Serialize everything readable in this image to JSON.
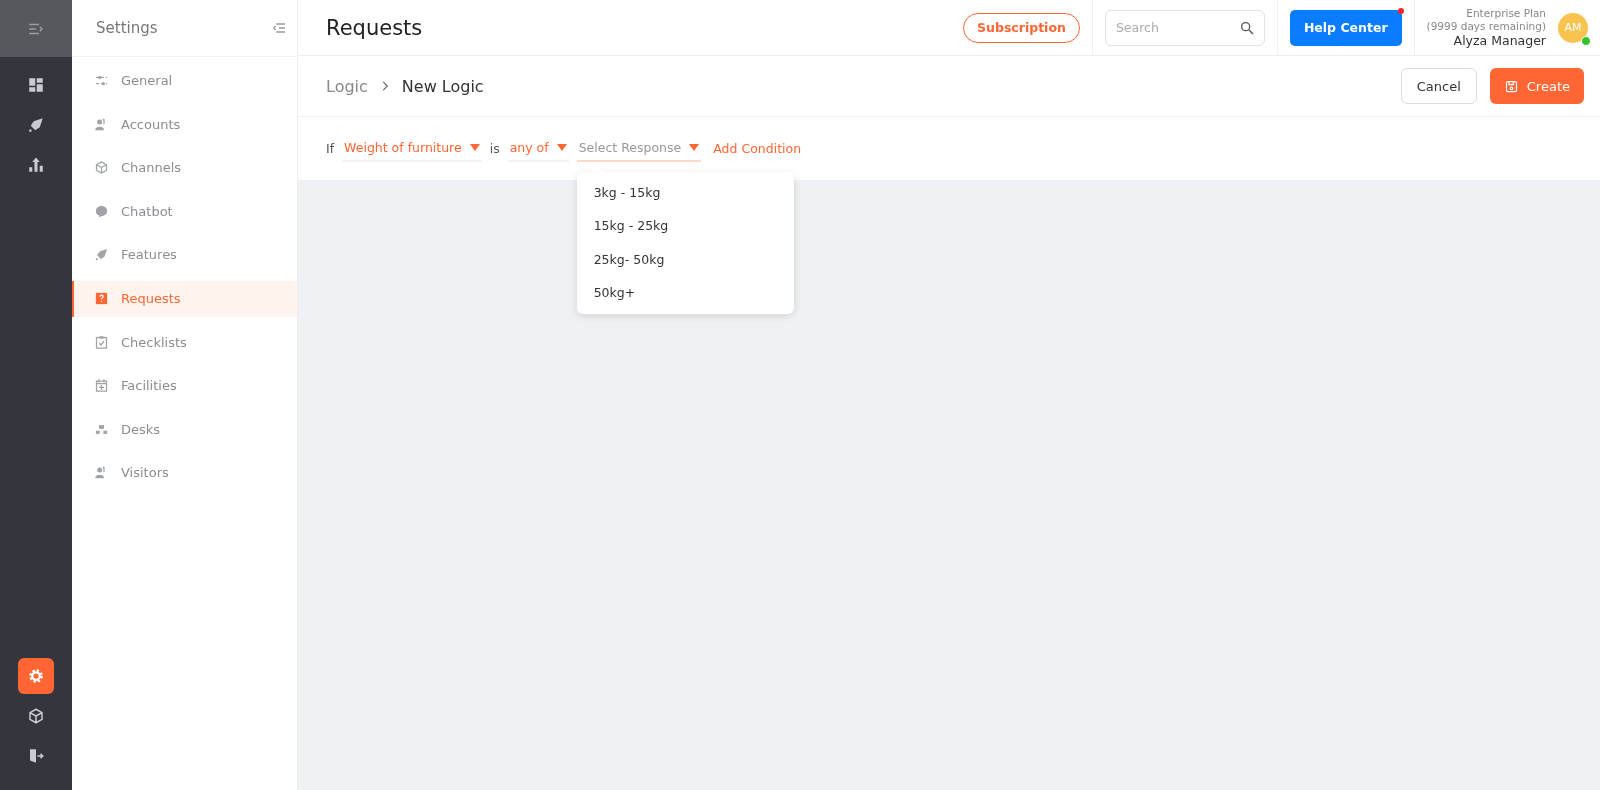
{
  "rail": {
    "items": [
      {
        "selected": false
      },
      {
        "selected": false
      },
      {
        "selected": false
      }
    ],
    "bottom_items": [
      {
        "selected": true
      },
      {
        "selected": false
      },
      {
        "selected": false
      }
    ]
  },
  "sidebar": {
    "title": "Settings",
    "items": [
      {
        "label": "General",
        "selected": false
      },
      {
        "label": "Accounts",
        "selected": false
      },
      {
        "label": "Channels",
        "selected": false
      },
      {
        "label": "Chatbot",
        "selected": false
      },
      {
        "label": "Features",
        "selected": false
      },
      {
        "label": "Requests",
        "selected": true
      },
      {
        "label": "Checklists",
        "selected": false
      },
      {
        "label": "Facilities",
        "selected": false
      },
      {
        "label": "Desks",
        "selected": false
      },
      {
        "label": "Visitors",
        "selected": false
      }
    ]
  },
  "header": {
    "title": "Requests",
    "subscription": "Subscription",
    "search": {
      "placeholder": "Search"
    },
    "help": "Help Center",
    "help_notification": true,
    "plan": "Enterprise Plan",
    "plan_remaining": "(9999 days remaining)",
    "user": "Alyza Manager",
    "avatar": "AM",
    "online": true
  },
  "breadcrumb": {
    "parent": "Logic",
    "current": "New Logic"
  },
  "actions": {
    "cancel": "Cancel",
    "create": "Create"
  },
  "condition": {
    "if": "If",
    "is": "is",
    "dropdowns": [
      {
        "value": "Weight of furniture"
      },
      {
        "value": "any of"
      },
      {
        "placeholder": "Select Response",
        "open": true,
        "options": [
          "3kg - 15kg",
          "15kg - 25kg",
          "25kg- 50kg",
          "50kg+"
        ]
      }
    ],
    "add": "Add Condition"
  }
}
